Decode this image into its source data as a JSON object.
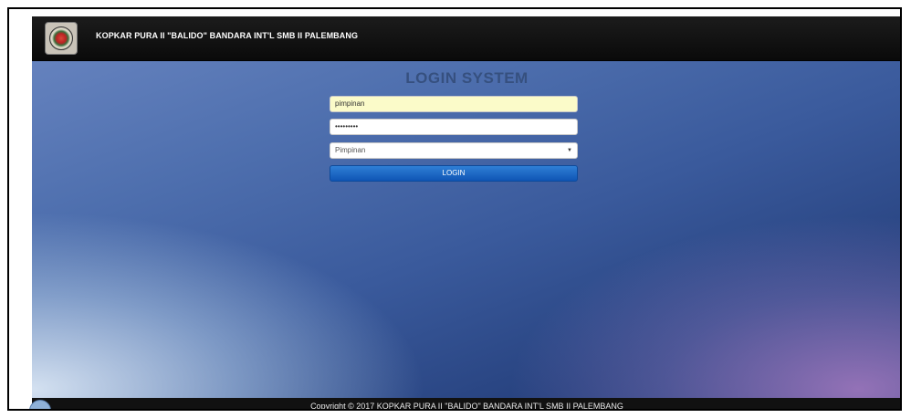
{
  "navbar": {
    "brand": "KOPKAR PURA II \"BALIDO\" BANDARA INT'L SMB II PALEMBANG",
    "logo_icon": "cooperative-emblem-icon"
  },
  "login": {
    "title": "LOGIN SYSTEM",
    "username_value": "pimpinan",
    "password_mask": "•••••••••",
    "role_selected": "Pimpinan",
    "button_label": "LOGIN"
  },
  "footer": {
    "copyright": "Copyright © 2017 KOPKAR PURA II \"BALIDO\" BANDARA INT'L SMB II PALEMBANG"
  },
  "colors": {
    "navbar": "#111111",
    "title": "#36507f",
    "username_bg": "#fbfbc9",
    "button": "#1d66c4"
  }
}
